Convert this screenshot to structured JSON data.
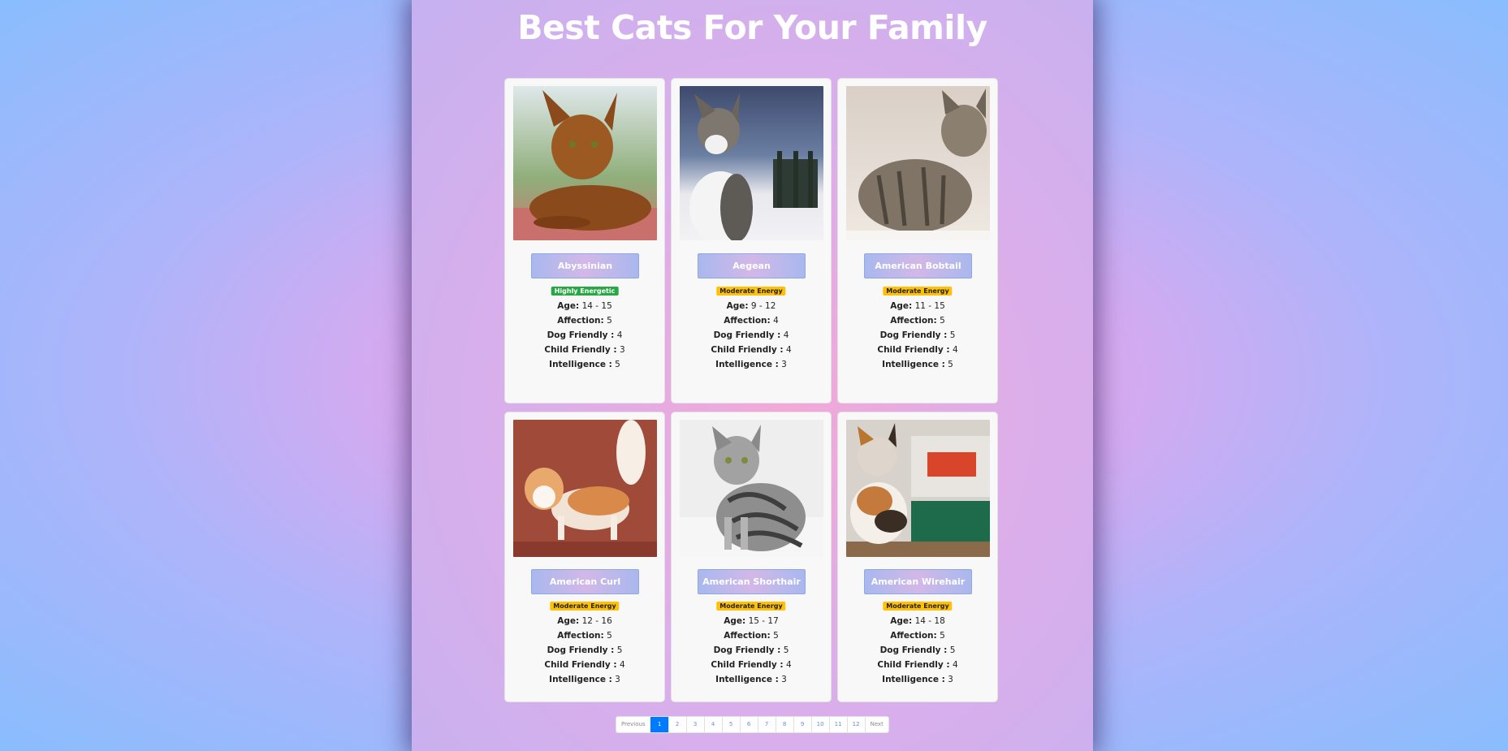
{
  "page": {
    "title": "Best Cats For Your Family"
  },
  "labels": {
    "age": "Age:",
    "affection": "Affection:",
    "dog_friendly": "Dog Friendly :",
    "child_friendly": "Child Friendly :",
    "intelligence": "Intelligence :"
  },
  "cats": [
    {
      "name": "Abyssinian",
      "energy": "Highly Energetic",
      "energy_color": "#28a745",
      "age": "14 - 15",
      "affection": "5",
      "dog_friendly": "4",
      "child_friendly": "3",
      "intelligence": "5"
    },
    {
      "name": "Aegean",
      "energy": "Moderate Energy",
      "energy_color": "#ffc107",
      "age": "9 - 12",
      "affection": "4",
      "dog_friendly": "4",
      "child_friendly": "4",
      "intelligence": "3"
    },
    {
      "name": "American Bobtail",
      "energy": "Moderate Energy",
      "energy_color": "#ffc107",
      "age": "11 - 15",
      "affection": "5",
      "dog_friendly": "5",
      "child_friendly": "4",
      "intelligence": "5"
    },
    {
      "name": "American Curl",
      "energy": "Moderate Energy",
      "energy_color": "#ffc107",
      "age": "12 - 16",
      "affection": "5",
      "dog_friendly": "5",
      "child_friendly": "4",
      "intelligence": "3"
    },
    {
      "name": "American Shorthair",
      "energy": "Moderate Energy",
      "energy_color": "#ffc107",
      "age": "15 - 17",
      "affection": "5",
      "dog_friendly": "5",
      "child_friendly": "4",
      "intelligence": "3"
    },
    {
      "name": "American Wirehair",
      "energy": "Moderate Energy",
      "energy_color": "#ffc107",
      "age": "14 - 18",
      "affection": "5",
      "dog_friendly": "5",
      "child_friendly": "4",
      "intelligence": "3"
    }
  ],
  "pagination": {
    "previous": "Previous",
    "next": "Next",
    "pages": [
      "1",
      "2",
      "3",
      "4",
      "5",
      "6",
      "7",
      "8",
      "9",
      "10",
      "11",
      "12"
    ],
    "active": "1"
  },
  "colors": {
    "active_page": "#007bff",
    "highly_energetic": "#28a745",
    "moderate_energy": "#ffc107"
  }
}
